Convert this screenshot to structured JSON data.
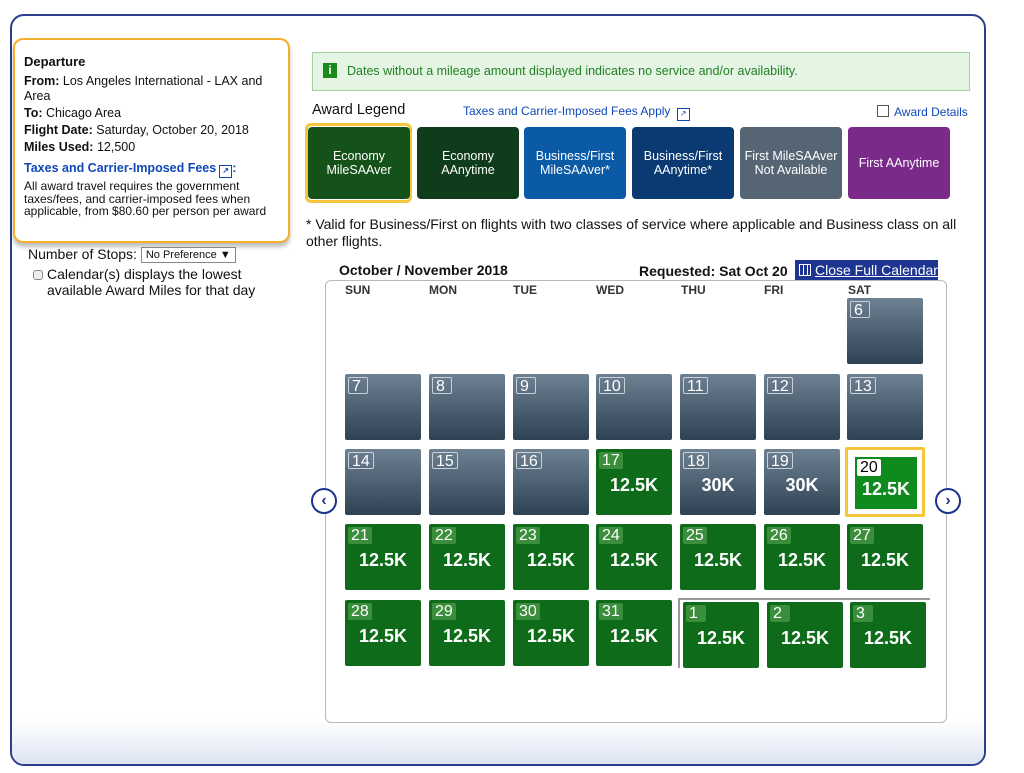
{
  "departure": {
    "title": "Departure",
    "from_label": "From:",
    "from_value": "Los Angeles International - LAX and Area",
    "to_label": "To:",
    "to_value": "Chicago Area",
    "date_label": "Flight Date:",
    "date_value": "Saturday, October 20, 2018",
    "miles_label": "Miles Used:",
    "miles_value": "12,500",
    "fees_link": "Taxes and Carrier-Imposed Fees",
    "fees_text": "All award travel requires the government taxes/fees, and carrier-imposed fees when applicable, from $80.60 per person per award"
  },
  "filters": {
    "stops_label": "Number of Stops:",
    "stops_value": "No Preference",
    "calendar_note": "Calendar(s) displays the lowest available Award Miles for that day"
  },
  "info_message": "Dates without a mileage amount displayed indicates no service and/or availability.",
  "legend": {
    "title": "Award Legend",
    "taxes_link": "Taxes and Carrier-Imposed Fees Apply",
    "details_link": "Award Details",
    "items": [
      {
        "label": "Economy MileSAAver",
        "color": "#15521a"
      },
      {
        "label": "Economy AAnytime",
        "color": "#0f3d1c"
      },
      {
        "label": "Business/First MileSAAver*",
        "color": "#0a5aa6"
      },
      {
        "label": "Business/First AAnytime*",
        "color": "#0b3a73"
      },
      {
        "label": "First MileSAAver Not Available",
        "color": "#566574"
      },
      {
        "label": "First AAnytime",
        "color": "#7a2b8a"
      }
    ],
    "footnote": "* Valid for Business/First on flights with two classes of service where applicable and Business class on all other flights."
  },
  "calendar": {
    "title": "October / November 2018",
    "requested": "Requested: Sat Oct 20",
    "close_link": "Close Full Calendar",
    "weekdays": [
      "SUN",
      "MON",
      "TUE",
      "WED",
      "THU",
      "FRI",
      "SAT"
    ],
    "days": [
      {
        "day": "6",
        "miles": "",
        "status": "none"
      },
      {
        "day": "7",
        "miles": "",
        "status": "none"
      },
      {
        "day": "8",
        "miles": "",
        "status": "none"
      },
      {
        "day": "9",
        "miles": "",
        "status": "none"
      },
      {
        "day": "10",
        "miles": "",
        "status": "none"
      },
      {
        "day": "11",
        "miles": "",
        "status": "none"
      },
      {
        "day": "12",
        "miles": "",
        "status": "none"
      },
      {
        "day": "13",
        "miles": "",
        "status": "none"
      },
      {
        "day": "14",
        "miles": "",
        "status": "none"
      },
      {
        "day": "15",
        "miles": "",
        "status": "none"
      },
      {
        "day": "16",
        "miles": "",
        "status": "none"
      },
      {
        "day": "17",
        "miles": "12.5K",
        "status": "economy"
      },
      {
        "day": "18",
        "miles": "30K",
        "status": "none"
      },
      {
        "day": "19",
        "miles": "30K",
        "status": "none"
      },
      {
        "day": "20",
        "miles": "12.5K",
        "status": "selected"
      },
      {
        "day": "21",
        "miles": "12.5K",
        "status": "economy"
      },
      {
        "day": "22",
        "miles": "12.5K",
        "status": "economy"
      },
      {
        "day": "23",
        "miles": "12.5K",
        "status": "economy"
      },
      {
        "day": "24",
        "miles": "12.5K",
        "status": "economy"
      },
      {
        "day": "25",
        "miles": "12.5K",
        "status": "economy"
      },
      {
        "day": "26",
        "miles": "12.5K",
        "status": "economy"
      },
      {
        "day": "27",
        "miles": "12.5K",
        "status": "economy"
      },
      {
        "day": "28",
        "miles": "12.5K",
        "status": "economy"
      },
      {
        "day": "29",
        "miles": "12.5K",
        "status": "economy"
      },
      {
        "day": "30",
        "miles": "12.5K",
        "status": "economy"
      },
      {
        "day": "31",
        "miles": "12.5K",
        "status": "economy"
      },
      {
        "day": "1",
        "miles": "12.5K",
        "status": "economy"
      },
      {
        "day": "2",
        "miles": "12.5K",
        "status": "economy"
      },
      {
        "day": "3",
        "miles": "12.5K",
        "status": "economy"
      }
    ]
  }
}
